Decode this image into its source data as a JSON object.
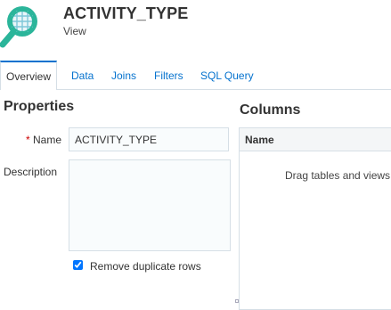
{
  "header": {
    "title": "ACTIVITY_TYPE",
    "subtitle": "View",
    "logo_icon": "view-search-icon",
    "accent_color": "#2bb59a"
  },
  "tabs": [
    {
      "label": "Overview",
      "active": true
    },
    {
      "label": "Data",
      "active": false
    },
    {
      "label": "Joins",
      "active": false
    },
    {
      "label": "Filters",
      "active": false
    },
    {
      "label": "SQL Query",
      "active": false
    }
  ],
  "properties": {
    "heading": "Properties",
    "name_required_marker": "*",
    "name_label": "Name",
    "name_value": "ACTIVITY_TYPE",
    "description_label": "Description",
    "description_value": "",
    "remove_duplicates_label": "Remove duplicate rows",
    "remove_duplicates_checked": true
  },
  "columns": {
    "heading": "Columns",
    "column_header": "Name",
    "empty_hint": "Drag tables and views"
  },
  "colors": {
    "link": "#0572ce",
    "border": "#d6dfe6",
    "required": "#cc0000"
  }
}
